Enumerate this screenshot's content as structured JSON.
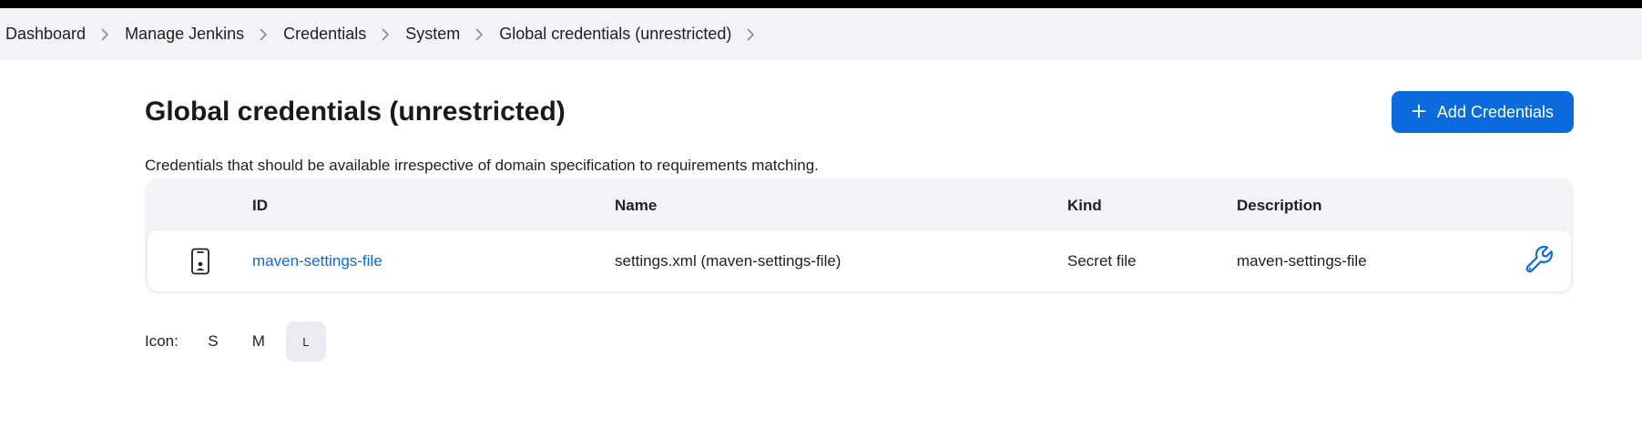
{
  "breadcrumb": {
    "items": [
      {
        "label": "Dashboard"
      },
      {
        "label": "Manage Jenkins"
      },
      {
        "label": "Credentials"
      },
      {
        "label": "System"
      },
      {
        "label": "Global credentials (unrestricted)"
      }
    ]
  },
  "header": {
    "title": "Global credentials (unrestricted)",
    "add_button_label": "Add Credentials"
  },
  "description": "Credentials that should be available irrespective of domain specification to requirements matching.",
  "table": {
    "columns": [
      "ID",
      "Name",
      "Kind",
      "Description"
    ],
    "rows": [
      {
        "icon": "mobile-credential-icon",
        "id": "maven-settings-file",
        "name": "settings.xml (maven-settings-file)",
        "kind": "Secret file",
        "description": "maven-settings-file",
        "action_icon": "wrench-icon"
      }
    ]
  },
  "icon_size": {
    "label": "Icon:",
    "options": [
      "S",
      "M",
      "L"
    ],
    "selected": "L"
  },
  "colors": {
    "accent": "#0b6bdc",
    "breadcrumb_bg": "#f3f3f5",
    "table_bg": "#f3f3f6"
  }
}
